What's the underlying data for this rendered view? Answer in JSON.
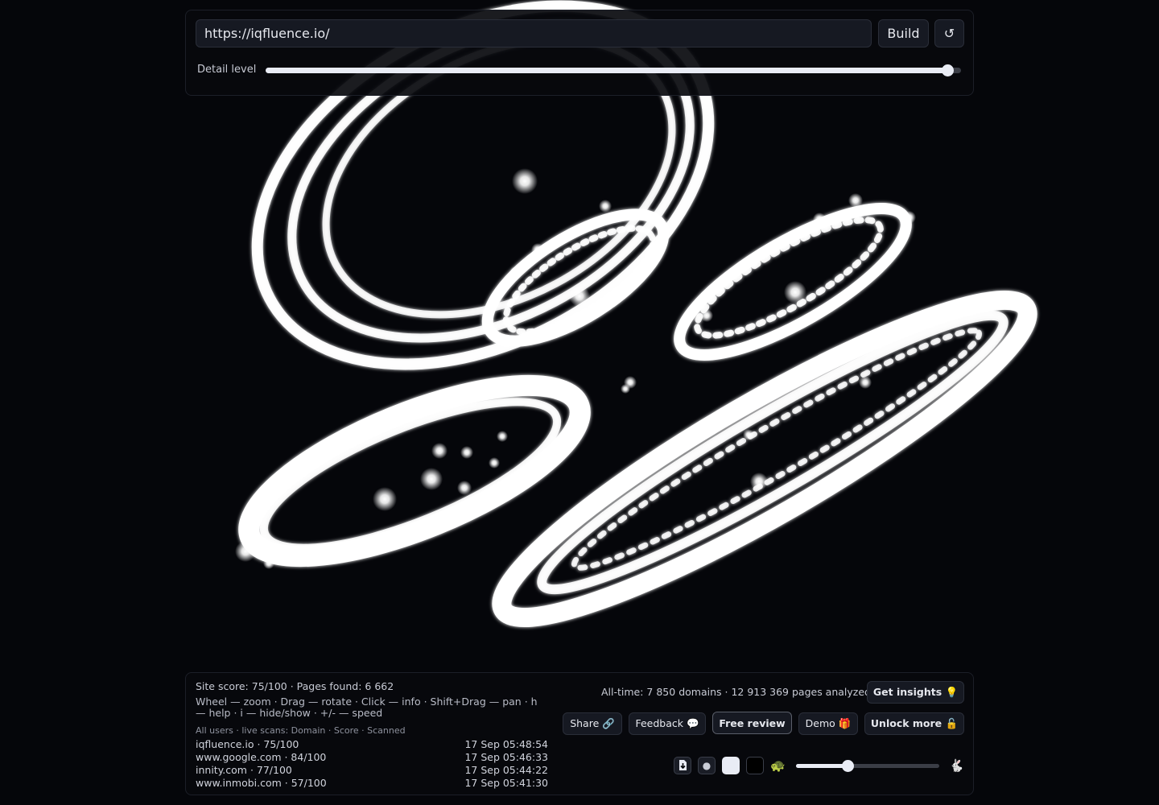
{
  "toolbar": {
    "url_value": "https://iqfluence.io/",
    "build_label": "Build",
    "reset_label": "↺",
    "detail_label": "Detail level",
    "detail_value": 0.98
  },
  "stats": {
    "summary": "Site score: 75/100 · Pages found: 6 662",
    "help": "Wheel — zoom · Drag — rotate · Click — info · Shift+Drag — pan · h — help · i — hide/show · +/- — speed",
    "alltime": "All-time: 7 850 domains · 12 913 369 pages analyzed"
  },
  "feed": {
    "header": "All users · live scans: Domain · Score · Scanned",
    "rows": [
      {
        "site": "iqfluence.io · 75/100",
        "time": "17 Sep 05:48:54"
      },
      {
        "site": "www.google.com · 84/100",
        "time": "17 Sep 05:46:33"
      },
      {
        "site": "innity.com · 77/100",
        "time": "17 Sep 05:44:22"
      },
      {
        "site": "www.inmobi.com · 57/100",
        "time": "17 Sep 05:41:30"
      }
    ]
  },
  "actions": {
    "insights": "Get insights 💡",
    "share": "Share 🔗",
    "feedback": "Feedback 💬",
    "review": "Free review",
    "demo": "Demo 🎁",
    "unlock": "Unlock more 🔓"
  },
  "controls": {
    "download_icon": "download-icon",
    "dot_icon": "●",
    "slow_icon": "🐢",
    "fast_icon": "🐇",
    "speed_value": 0.36
  },
  "colors": {
    "background": "#05060a",
    "panel": "#08090d",
    "accent": "#e9ecf5"
  }
}
